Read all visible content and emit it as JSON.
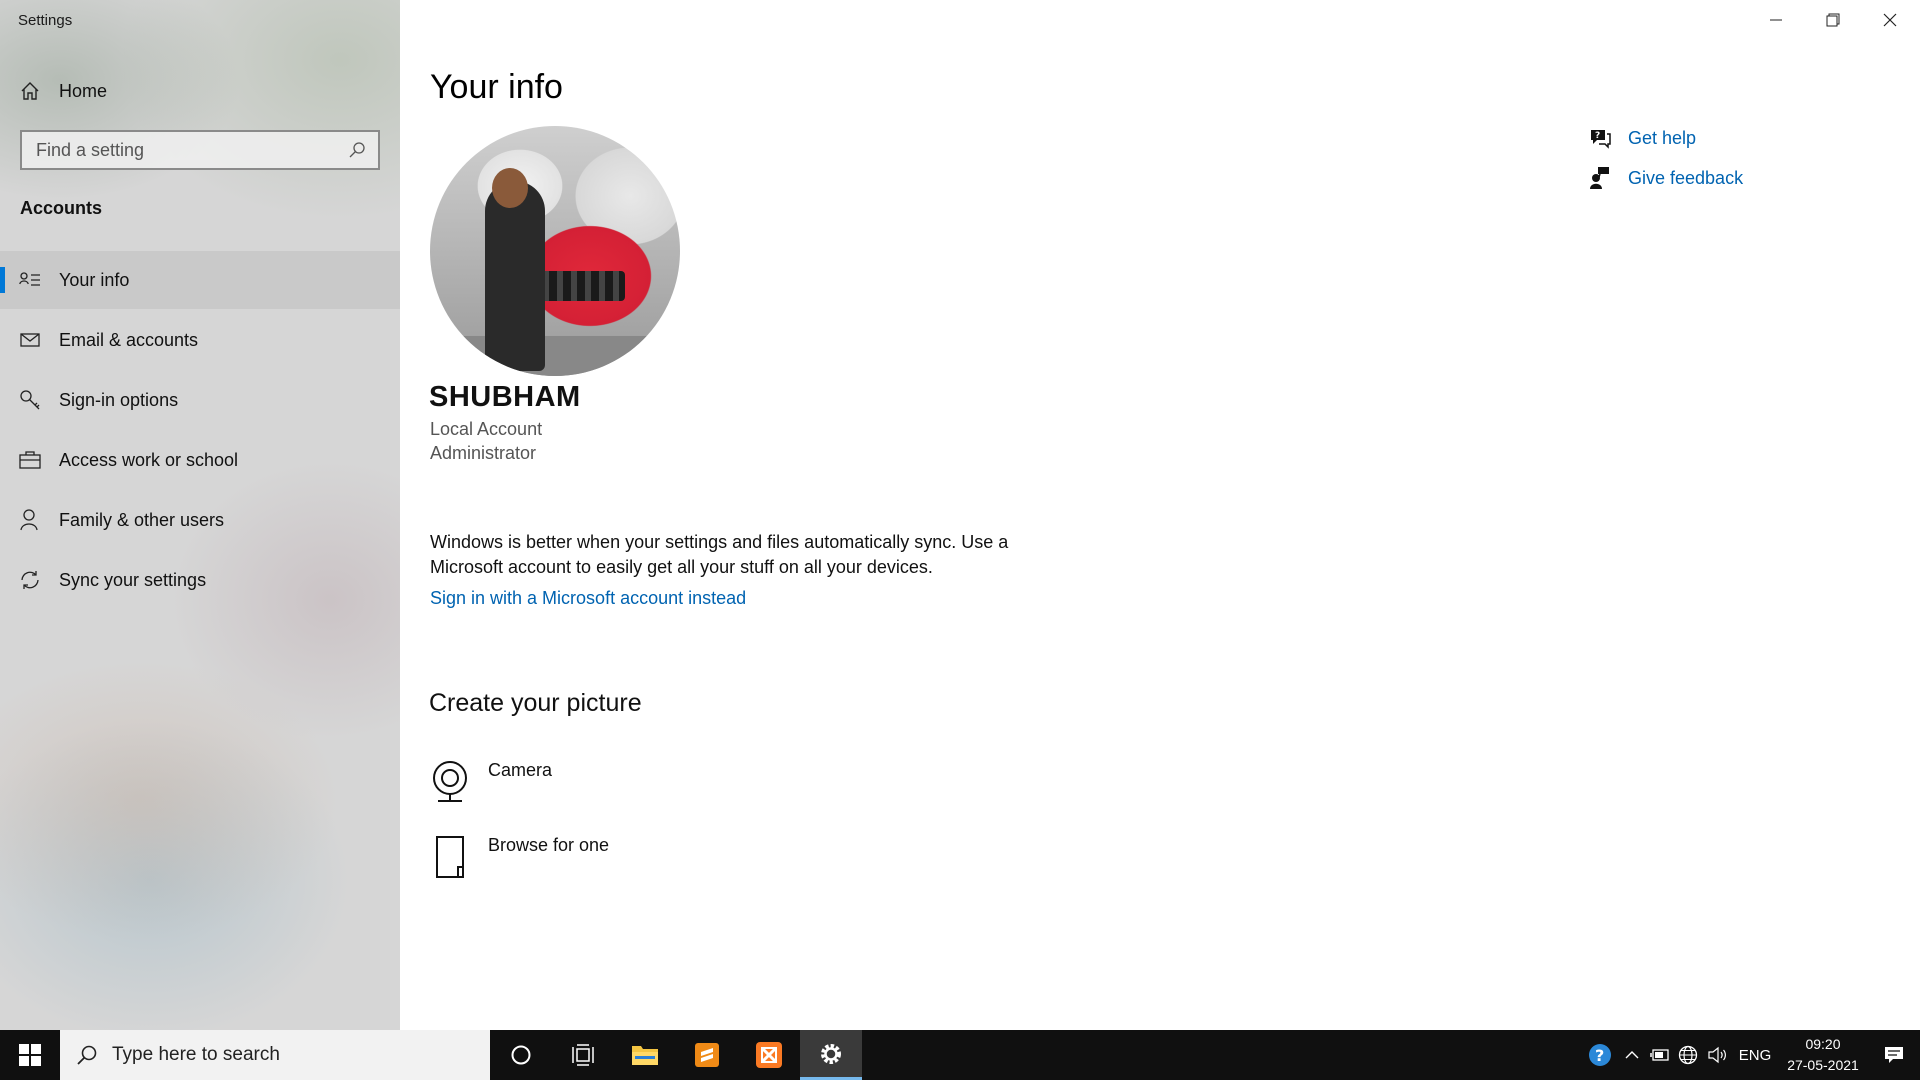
{
  "window": {
    "title": "Settings"
  },
  "sidebar": {
    "home_label": "Home",
    "search_placeholder": "Find a setting",
    "section_header": "Accounts",
    "items": [
      {
        "label": "Your info",
        "icon": "contact-card-icon",
        "selected": true
      },
      {
        "label": "Email & accounts",
        "icon": "mail-icon",
        "selected": false
      },
      {
        "label": "Sign-in options",
        "icon": "key-icon",
        "selected": false
      },
      {
        "label": "Access work or school",
        "icon": "briefcase-icon",
        "selected": false
      },
      {
        "label": "Family & other users",
        "icon": "person-icon",
        "selected": false
      },
      {
        "label": "Sync your settings",
        "icon": "sync-icon",
        "selected": false
      }
    ]
  },
  "main": {
    "page_title": "Your info",
    "user": {
      "name": "SHUBHAM",
      "account_type": "Local Account",
      "role": "Administrator"
    },
    "sync_text": "Windows is better when your settings and files automatically sync. Use a Microsoft account to easily get all your stuff on all your devices.",
    "signin_link": "Sign in with a Microsoft account instead",
    "create_heading": "Create your picture",
    "picture_options": [
      {
        "label": "Camera",
        "icon": "webcam-icon"
      },
      {
        "label": "Browse for one",
        "icon": "document-icon"
      }
    ],
    "help_links": [
      {
        "label": "Get help",
        "icon": "help-chat-icon"
      },
      {
        "label": "Give feedback",
        "icon": "feedback-icon"
      }
    ]
  },
  "taskbar": {
    "search_placeholder": "Type here to search",
    "language": "ENG",
    "time": "09:20",
    "date": "27-05-2021"
  },
  "colors": {
    "accent": "#0078d7",
    "link": "#0063b1",
    "taskbar": "#101010"
  }
}
